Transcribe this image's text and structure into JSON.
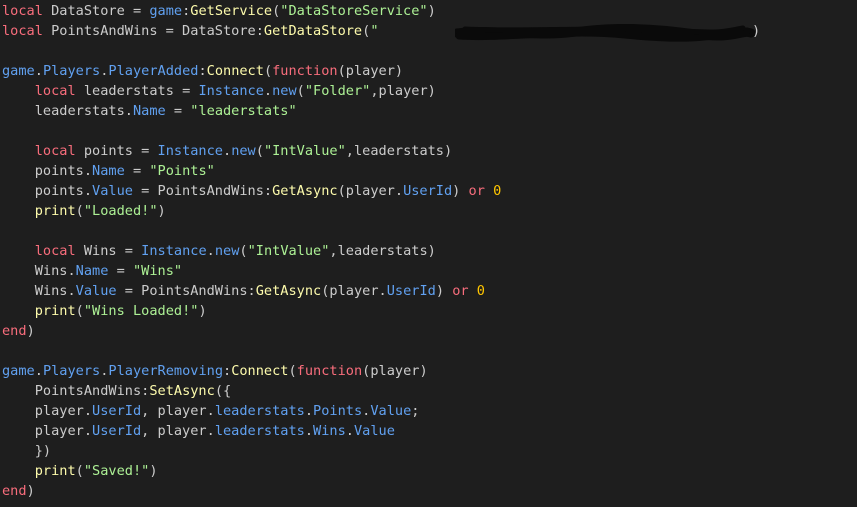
{
  "editor": {
    "background": "#1e1e1e",
    "colors": {
      "keyword": "#f86d7c",
      "string": "#adf195",
      "number": "#ffc600",
      "member": "#61a1f1",
      "method": "#fdfbac",
      "plain": "#cccccc"
    },
    "lines": [
      [
        [
          "kw",
          "local"
        ],
        [
          "id",
          " DataStore = "
        ],
        [
          "mem",
          "game"
        ],
        [
          "op",
          ":"
        ],
        [
          "fn",
          "GetService"
        ],
        [
          "op",
          "("
        ],
        [
          "str",
          "\"DataStoreService\""
        ],
        [
          "op",
          ")"
        ]
      ],
      [
        [
          "kw",
          "local"
        ],
        [
          "id",
          " PointsAndWins = DataStore:"
        ],
        [
          "fn",
          "GetDataStore"
        ],
        [
          "op",
          "("
        ],
        [
          "str",
          "\""
        ]
      ],
      [],
      [
        [
          "mem",
          "game"
        ],
        [
          "op",
          "."
        ],
        [
          "mem",
          "Players"
        ],
        [
          "op",
          "."
        ],
        [
          "mem",
          "PlayerAdded"
        ],
        [
          "op",
          ":"
        ],
        [
          "fn",
          "Connect"
        ],
        [
          "op",
          "("
        ],
        [
          "kw",
          "function"
        ],
        [
          "op",
          "(player)"
        ]
      ],
      [
        [
          "id",
          "    "
        ],
        [
          "kw",
          "local"
        ],
        [
          "id",
          " leaderstats = "
        ],
        [
          "mem",
          "Instance"
        ],
        [
          "op",
          "."
        ],
        [
          "mem",
          "new"
        ],
        [
          "op",
          "("
        ],
        [
          "str",
          "\"Folder\""
        ],
        [
          "op",
          ",player)"
        ]
      ],
      [
        [
          "id",
          "    leaderstats."
        ],
        [
          "mem",
          "Name"
        ],
        [
          "id",
          " = "
        ],
        [
          "str",
          "\"leaderstats\""
        ]
      ],
      [],
      [
        [
          "id",
          "    "
        ],
        [
          "kw",
          "local"
        ],
        [
          "id",
          " points = "
        ],
        [
          "mem",
          "Instance"
        ],
        [
          "op",
          "."
        ],
        [
          "mem",
          "new"
        ],
        [
          "op",
          "("
        ],
        [
          "str",
          "\"IntValue\""
        ],
        [
          "op",
          ",leaderstats)"
        ]
      ],
      [
        [
          "id",
          "    points."
        ],
        [
          "mem",
          "Name"
        ],
        [
          "id",
          " = "
        ],
        [
          "str",
          "\"Points\""
        ]
      ],
      [
        [
          "id",
          "    points."
        ],
        [
          "mem",
          "Value"
        ],
        [
          "id",
          " = PointsAndWins:"
        ],
        [
          "fn",
          "GetAsync"
        ],
        [
          "op",
          "(player."
        ],
        [
          "mem",
          "UserId"
        ],
        [
          "op",
          ") "
        ],
        [
          "kw",
          "or"
        ],
        [
          "id",
          " "
        ],
        [
          "num",
          "0"
        ]
      ],
      [
        [
          "id",
          "    "
        ],
        [
          "fn",
          "print"
        ],
        [
          "op",
          "("
        ],
        [
          "str",
          "\"Loaded!\""
        ],
        [
          "op",
          ")"
        ]
      ],
      [],
      [
        [
          "id",
          "    "
        ],
        [
          "kw",
          "local"
        ],
        [
          "id",
          " Wins = "
        ],
        [
          "mem",
          "Instance"
        ],
        [
          "op",
          "."
        ],
        [
          "mem",
          "new"
        ],
        [
          "op",
          "("
        ],
        [
          "str",
          "\"IntValue\""
        ],
        [
          "op",
          ",leaderstats)"
        ]
      ],
      [
        [
          "id",
          "    Wins."
        ],
        [
          "mem",
          "Name"
        ],
        [
          "id",
          " = "
        ],
        [
          "str",
          "\"Wins\""
        ]
      ],
      [
        [
          "id",
          "    Wins."
        ],
        [
          "mem",
          "Value"
        ],
        [
          "id",
          " = PointsAndWins:"
        ],
        [
          "fn",
          "GetAsync"
        ],
        [
          "op",
          "(player."
        ],
        [
          "mem",
          "UserId"
        ],
        [
          "op",
          ") "
        ],
        [
          "kw",
          "or"
        ],
        [
          "id",
          " "
        ],
        [
          "num",
          "0"
        ]
      ],
      [
        [
          "id",
          "    "
        ],
        [
          "fn",
          "print"
        ],
        [
          "op",
          "("
        ],
        [
          "str",
          "\"Wins Loaded!\""
        ],
        [
          "op",
          ")"
        ]
      ],
      [
        [
          "kw",
          "end"
        ],
        [
          "op",
          ")"
        ]
      ],
      [],
      [
        [
          "mem",
          "game"
        ],
        [
          "op",
          "."
        ],
        [
          "mem",
          "Players"
        ],
        [
          "op",
          "."
        ],
        [
          "mem",
          "PlayerRemoving"
        ],
        [
          "op",
          ":"
        ],
        [
          "fn",
          "Connect"
        ],
        [
          "op",
          "("
        ],
        [
          "kw",
          "function"
        ],
        [
          "op",
          "(player)"
        ]
      ],
      [
        [
          "id",
          "    PointsAndWins:"
        ],
        [
          "fn",
          "SetAsync"
        ],
        [
          "op",
          "({"
        ]
      ],
      [
        [
          "id",
          "    player."
        ],
        [
          "mem",
          "UserId"
        ],
        [
          "id",
          ", player."
        ],
        [
          "mem",
          "leaderstats"
        ],
        [
          "op",
          "."
        ],
        [
          "mem",
          "Points"
        ],
        [
          "op",
          "."
        ],
        [
          "mem",
          "Value"
        ],
        [
          "op",
          ";"
        ]
      ],
      [
        [
          "id",
          "    player."
        ],
        [
          "mem",
          "UserId"
        ],
        [
          "id",
          ", player."
        ],
        [
          "mem",
          "leaderstats"
        ],
        [
          "op",
          "."
        ],
        [
          "mem",
          "Wins"
        ],
        [
          "op",
          "."
        ],
        [
          "mem",
          "Value"
        ]
      ],
      [
        [
          "id",
          "    })"
        ]
      ],
      [
        [
          "id",
          "    "
        ],
        [
          "fn",
          "print"
        ],
        [
          "op",
          "("
        ],
        [
          "str",
          "\"Saved!\""
        ],
        [
          "op",
          ")"
        ]
      ],
      [
        [
          "kw",
          "end"
        ],
        [
          "op",
          ")"
        ]
      ]
    ],
    "line2_tail": ")"
  }
}
